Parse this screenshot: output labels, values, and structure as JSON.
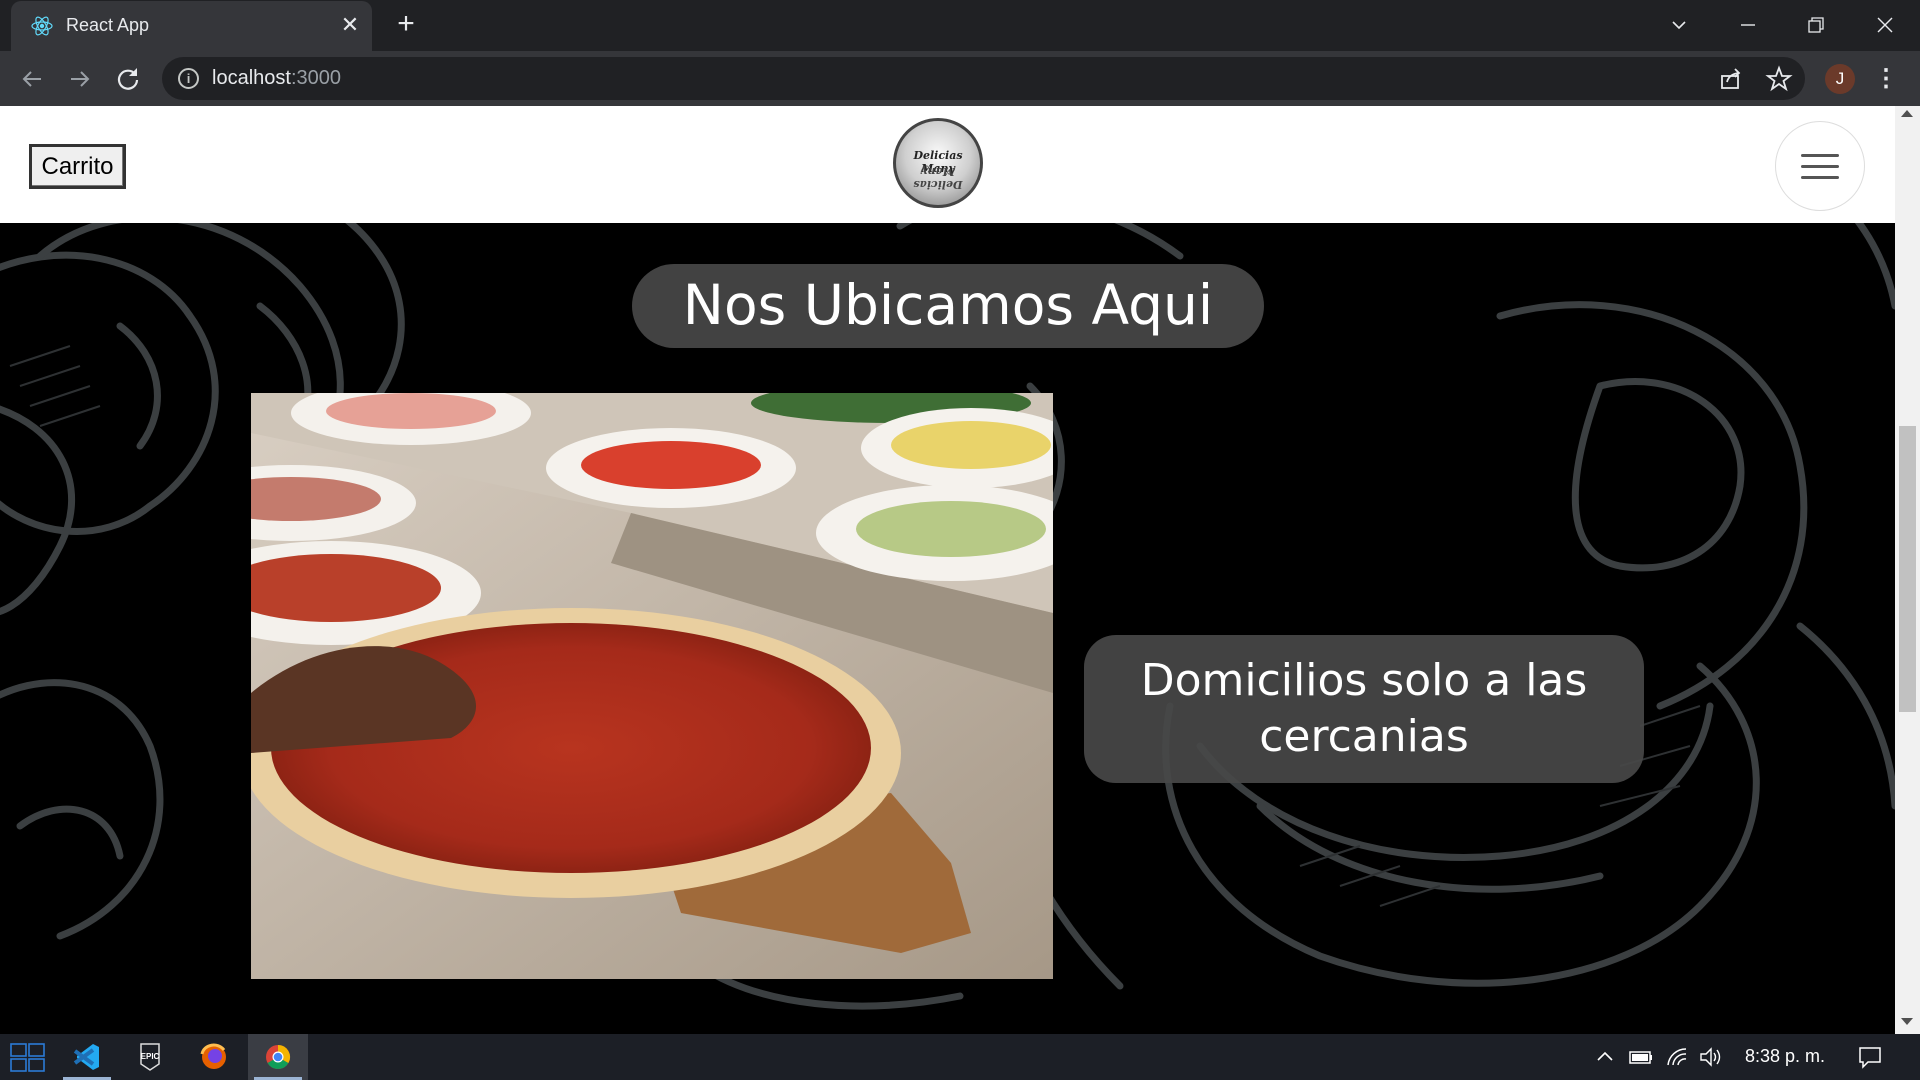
{
  "browser": {
    "tab_title": "React App",
    "url_host": "localhost",
    "url_port": ":3000",
    "tab_close": "✕",
    "new_tab": "+",
    "profile_initial": "J"
  },
  "page": {
    "cart_button": "Carrito",
    "logo_text": "Delicias Many",
    "heading": "Nos Ubicamos Aqui",
    "delivery_text": "Domicilios solo a las cercanias"
  },
  "taskbar": {
    "clock": "8:38 p. m."
  },
  "colors": {
    "chrome_dark": "#202124",
    "chrome_toolbar": "#35363a",
    "pill_bg": "#484848",
    "page_bg": "#000000",
    "navbar_bg": "#ffffff",
    "taskbar_bg": "#1c1f26"
  },
  "icons": [
    "react-icon",
    "close-icon",
    "plus-icon",
    "chevron-down-icon",
    "minimize-icon",
    "restore-icon",
    "window-close-icon",
    "back-icon",
    "forward-icon",
    "reload-icon",
    "info-icon",
    "share-icon",
    "star-icon",
    "more-icon",
    "hamburger-icon",
    "windows-start-icon",
    "vscode-icon",
    "epic-games-icon",
    "firefox-icon",
    "chrome-icon",
    "chevron-up-icon",
    "battery-icon",
    "wifi-icon",
    "volume-icon",
    "notification-icon"
  ]
}
